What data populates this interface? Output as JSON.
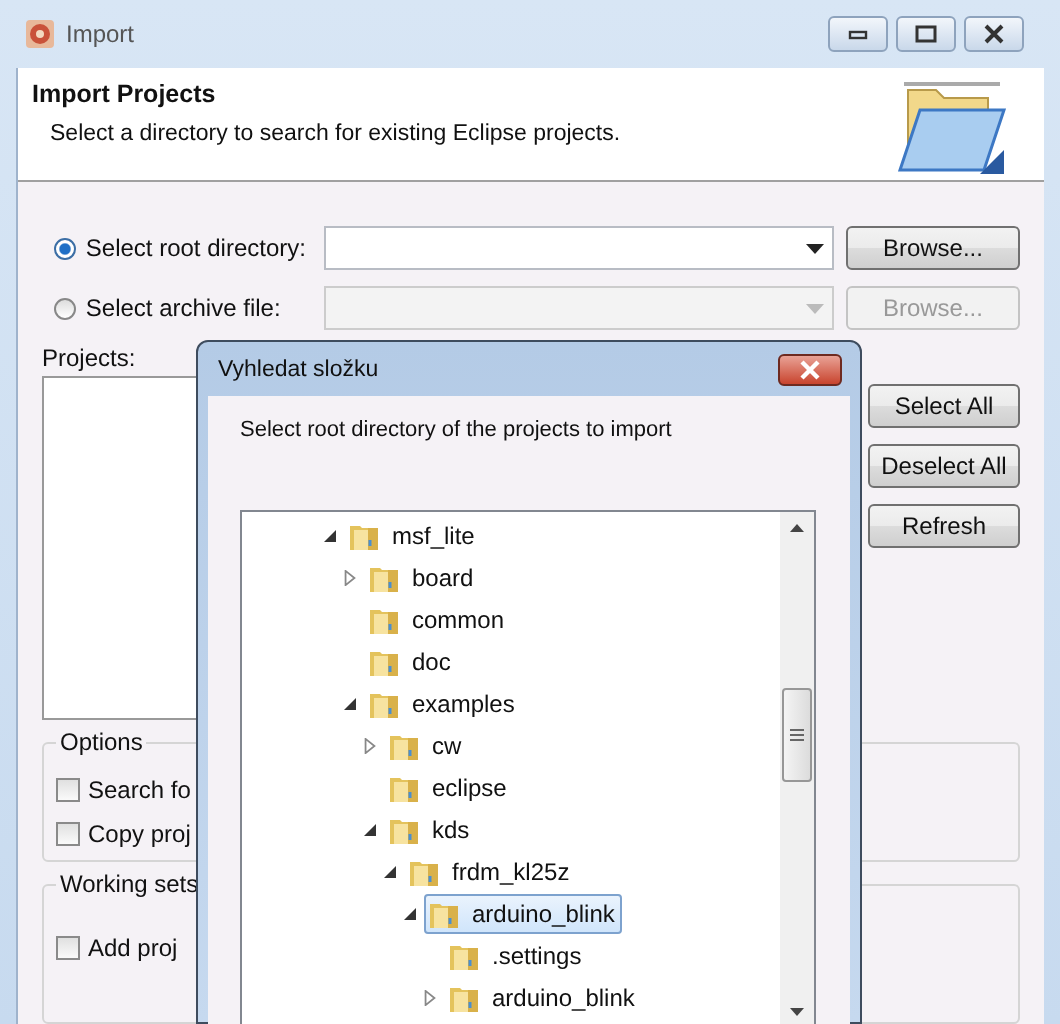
{
  "window": {
    "title": "Import"
  },
  "header": {
    "title": "Import Projects",
    "description": "Select a directory to search for existing Eclipse projects."
  },
  "sources": [
    {
      "label": "Select root directory:",
      "selected": true,
      "disabled": false,
      "button": "Browse..."
    },
    {
      "label": "Select archive file:",
      "selected": false,
      "disabled": true,
      "button": "Browse..."
    }
  ],
  "projects": {
    "label": "Projects:",
    "buttons": [
      "Select All",
      "Deselect All",
      "Refresh"
    ]
  },
  "options": {
    "title": "Options",
    "checkboxes": [
      {
        "label": "Search fo",
        "checked": false
      },
      {
        "label": "Copy proj",
        "checked": false
      }
    ]
  },
  "working_sets": {
    "title": "Working sets",
    "checkboxes": [
      {
        "label": "Add proj",
        "checked": false
      }
    ]
  },
  "folder_dialog": {
    "title": "Vyhledat složku",
    "prompt": "Select root directory of the projects to import",
    "tree": [
      {
        "label": "msf_lite",
        "kind": "expanded",
        "selected": false,
        "children": [
          {
            "label": "board",
            "kind": "collapsed",
            "selected": false
          },
          {
            "label": "common",
            "kind": "leaf",
            "selected": false
          },
          {
            "label": "doc",
            "kind": "leaf",
            "selected": false
          },
          {
            "label": "examples",
            "kind": "expanded",
            "selected": false,
            "children": [
              {
                "label": "cw",
                "kind": "collapsed",
                "selected": false
              },
              {
                "label": "eclipse",
                "kind": "leaf",
                "selected": false
              },
              {
                "label": "kds",
                "kind": "expanded",
                "selected": false,
                "children": [
                  {
                    "label": "frdm_kl25z",
                    "kind": "expanded",
                    "selected": false,
                    "children": [
                      {
                        "label": "arduino_blink",
                        "kind": "expanded",
                        "selected": true,
                        "children": [
                          {
                            "label": ".settings",
                            "kind": "leaf",
                            "selected": false
                          },
                          {
                            "label": "arduino_blink",
                            "kind": "collapsed",
                            "selected": false
                          }
                        ]
                      }
                    ]
                  }
                ]
              }
            ]
          }
        ]
      }
    ]
  }
}
